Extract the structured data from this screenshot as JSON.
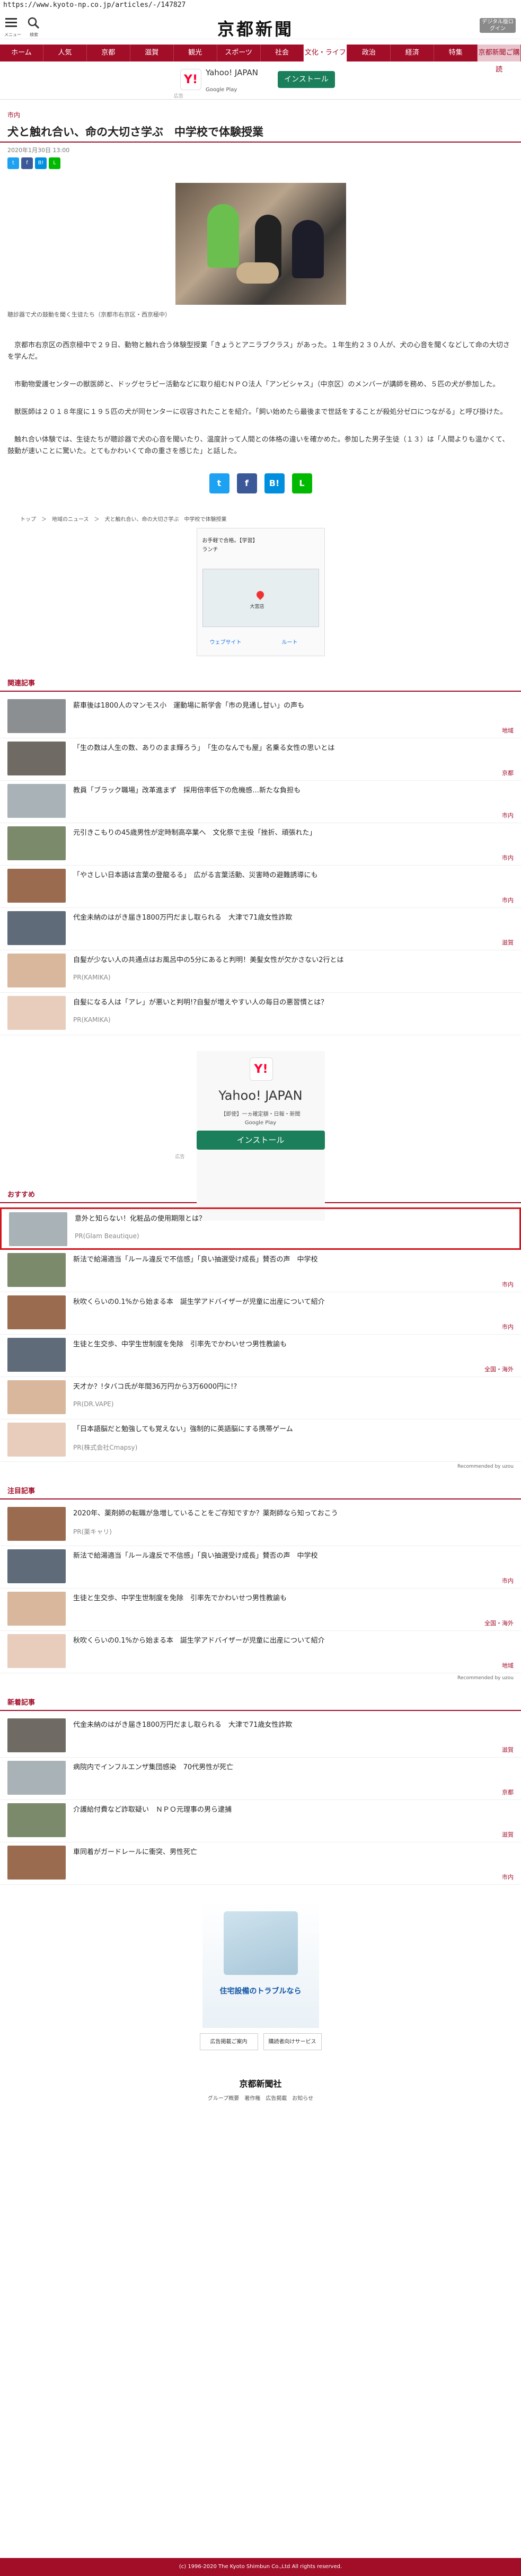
{
  "address": "https://www.kyoto-np.co.jp/articles/-/147827",
  "header": {
    "menu_label": "メニュー",
    "search_label": "検索",
    "logo": "京都新聞",
    "digital_btn": "デジタル版ログイン"
  },
  "nav": [
    "ホーム",
    "人気",
    "京都",
    "滋賀",
    "観光",
    "スポーツ",
    "社会",
    "文化・ライフ",
    "政治",
    "経済",
    "特集",
    "京都新聞ご購読"
  ],
  "ad1": {
    "brand": "Yahoo! JAPAN",
    "store": "Google Play",
    "install": "インストール",
    "label": "広告"
  },
  "article": {
    "category": "市内",
    "title": "犬と触れ合い、命の大切さ学ぶ　中学校で体験授業",
    "date": "2020年1月30日 13:00",
    "caption": "聴診器で犬の鼓動を聞く生徒たち（京都市右京区・西京極中）",
    "p1": "　京都市右京区の西京極中で２９日、動物と触れ合う体験型授業「きょうとアニラブクラス」があった。１年生約２３０人が、犬の心音を聞くなどして命の大切さを学んだ。",
    "p2": "　市動物愛護センターの獣医師と、ドッグセラピー活動などに取り組むＮＰＯ法人「アンビシャス」（中京区）のメンバーが講師を務め、５匹の犬が参加した。",
    "p3": "　獣医師は２０１８年度に１９５匹の犬が同センターに収容されたことを紹介。「飼い始めたら最後まで世話をすることが殺処分ゼロにつながる」と呼び掛けた。",
    "p4": "　触れ合い体験では、生徒たちが聴診器で犬の心音を聞いたり、温度計って人間との体格の違いを確かめた。参加した男子生徒（１３）は「人間よりも温かくて、鼓動が速いことに驚いた。とてもかわいくて命の重さを感じた」と話した。"
  },
  "share": {
    "tw": "t",
    "fb": "f",
    "hb": "B!",
    "line": "L"
  },
  "crumb": "トップ　＞　地域のニュース　＞　犬と触れ合い、命の大切さ学ぶ　中学校で体験授業",
  "mapad": {
    "title": "お手軽で合格。【学習】",
    "sub": "ランチ",
    "place": "大宮店",
    "route": "ルート",
    "call": "ウェブサイト"
  },
  "related": {
    "header": "関連記事",
    "items": [
      {
        "t": "薪車後は1800人のマンモス小　運動場に新学舎「市の見通し甘い」の声も",
        "c": "地域"
      },
      {
        "t": "「生の数は人生の数、ありのまま輝ろう」　「生のなんでも屋」名乗る女性の思いとは",
        "c": "京都"
      },
      {
        "t": "教員「ブラック職場」改革進まず　採用倍率低下の危機感…新たな負担も",
        "c": "市内"
      },
      {
        "t": "元引きこもりの45歳男性が定時制高卒業へ　文化祭で主役「挫折、頑張れた」",
        "c": "市内"
      },
      {
        "t": "「やさしい日本語は言葉の登龍るる」　広がる言葉活動、災害時の避難誘導にも",
        "c": "市内"
      },
      {
        "t": "代金未納のはがき届き1800万円だまし取られる　大津で71歳女性詐欺",
        "c": "滋賀"
      },
      {
        "t": "自髪が少ない人の共通点はお風呂中の5分にあると判明！美髪女性が欠かさない2行とは",
        "c": "PR(KAMIKA)"
      },
      {
        "t": "自髪になる人は「アレ」が悪いと判明!?自髪が増えやすい人の毎日の悪習慣とは？",
        "c": "PR(KAMIKA)"
      }
    ]
  },
  "ad2": {
    "brand": "Yahoo! JAPAN",
    "desc": "【即使】一ヵ確定額・日報・新聞",
    "store": "Google Play",
    "install": "インストール",
    "label": "広告"
  },
  "recommend": {
    "header": "おすすめ",
    "items": [
      {
        "t": "意外と知らない！化粧品の使用期限とは？",
        "c": "PR(Glam Beautique)"
      },
      {
        "t": "新法で給湯適当「ルール違反で不信感」「良い抽選受け成長」賛否の声　中学校",
        "c": "市内"
      },
      {
        "t": "秋吹くらいの0.1%から始まる本　誕生学アドバイザーが児童に出産について紹介",
        "c": "市内"
      },
      {
        "t": "生徒と生交歩、中学生世制度を免除　引率先でかわいせつ男性教諭も",
        "c": "全国・海外"
      },
      {
        "t": "天才か？!タバコ氏が年間36万円から3万6000円に!?",
        "c": "PR(DR.VAPE)"
      },
      {
        "t": "「日本語脳だと勉強しても覚えない」強制的に英語脳にする携帯ゲーム",
        "c": "PR(株式会社Cmapsy)"
      }
    ],
    "by": "Recommended by uzou"
  },
  "attention": {
    "header": "注目記事",
    "items": [
      {
        "t": "2020年、薬剤師の転職が急増していることをご存知ですか？薬剤師なら知っておこう",
        "c": "PR(薬キャリ)"
      },
      {
        "t": "新法で給湯適当「ルール違反で不信感」「良い抽選受け成長」賛否の声　中学校",
        "c": "市内"
      },
      {
        "t": "生徒と生交歩、中学生世制度を免除　引率先でかわいせつ男性教諭も",
        "c": "全国・海外"
      },
      {
        "t": "秋吹くらいの0.1%から始まる本　誕生学アドバイザーが児童に出産について紹介",
        "c": "地域"
      }
    ],
    "by": "Recommended by uzou"
  },
  "latest": {
    "header": "新着記事",
    "items": [
      {
        "t": "代金未納のはがき届き1800万円だまし取られる　大津で71歳女性詐欺",
        "c": "滋賀"
      },
      {
        "t": "病院内でインフルエンザ集団感染　70代男性が死亡",
        "c": "京都"
      },
      {
        "t": "介護給付費など詐取疑い　ＮＰＯ元理事の男ら逮捕",
        "c": "滋賀"
      },
      {
        "t": "車同着がガードレールに衝突、男性死亡",
        "c": "市内"
      }
    ]
  },
  "ad3": {
    "text": "住宅設備のトラブルなら"
  },
  "bottomlinks": {
    "a": "広告掲載ご案内",
    "b": "購読者向けサービス"
  },
  "footer": {
    "logo": "京都新聞社",
    "links": "グループ概要　著作権　広告掲載　お知らせ",
    "copy": "(c) 1996-2020 The Kyoto Shimbun Co.,Ltd All rights reserved."
  }
}
